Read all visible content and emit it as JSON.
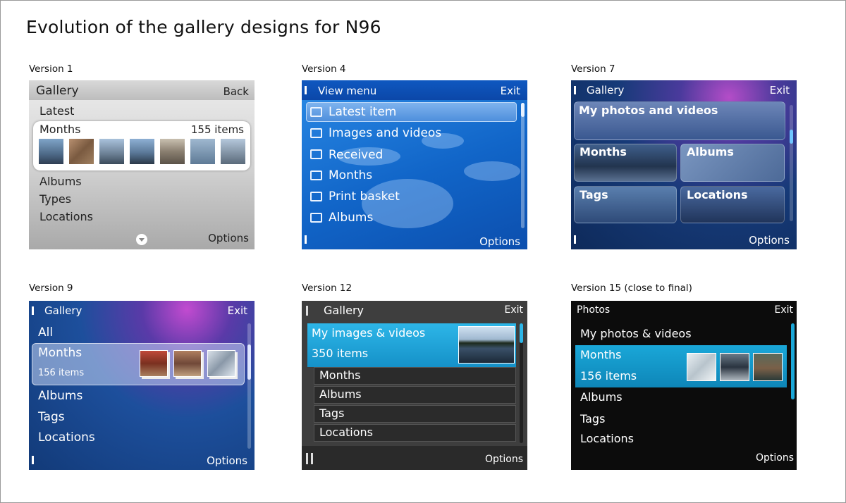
{
  "title": "Evolution of the gallery designs for N96",
  "versions": {
    "v1": {
      "label": "Version 1",
      "header_title": "Gallery",
      "header_right": "Back",
      "items": [
        "Latest",
        "Months",
        "Albums",
        "Types",
        "Locations"
      ],
      "highlight_count": "155 items",
      "softkey_right": "Options"
    },
    "v4": {
      "label": "Version 4",
      "header_title": "View menu",
      "header_right": "Exit",
      "items": [
        "Latest item",
        "Images and videos",
        "Received",
        "Months",
        "Print basket",
        "Albums"
      ],
      "softkey_right": "Options"
    },
    "v7": {
      "label": "Version 7",
      "header_title": "Gallery",
      "header_right": "Exit",
      "tiles": [
        "My photos and videos",
        "Months",
        "Albums",
        "Tags",
        "Locations"
      ],
      "softkey_right": "Options"
    },
    "v9": {
      "label": "Version 9",
      "header_title": "Gallery",
      "header_right": "Exit",
      "items": [
        "All",
        "Months",
        "Albums",
        "Tags",
        "Locations"
      ],
      "highlight_count": "156 items",
      "softkey_right": "Options"
    },
    "v12": {
      "label": "Version 12",
      "header_title": "Gallery",
      "header_right": "Exit",
      "highlight_title": "My images & videos",
      "highlight_count": "350 items",
      "items": [
        "Months",
        "Albums",
        "Tags",
        "Locations"
      ],
      "softkey_right": "Options"
    },
    "v15": {
      "label": "Version 15 (close to final)",
      "header_title": "Photos",
      "header_right": "Exit",
      "items": [
        "My photos & videos",
        "Months",
        "Albums",
        "Tags",
        "Locations"
      ],
      "highlight_count": "156 items",
      "softkey_right": "Options"
    }
  }
}
